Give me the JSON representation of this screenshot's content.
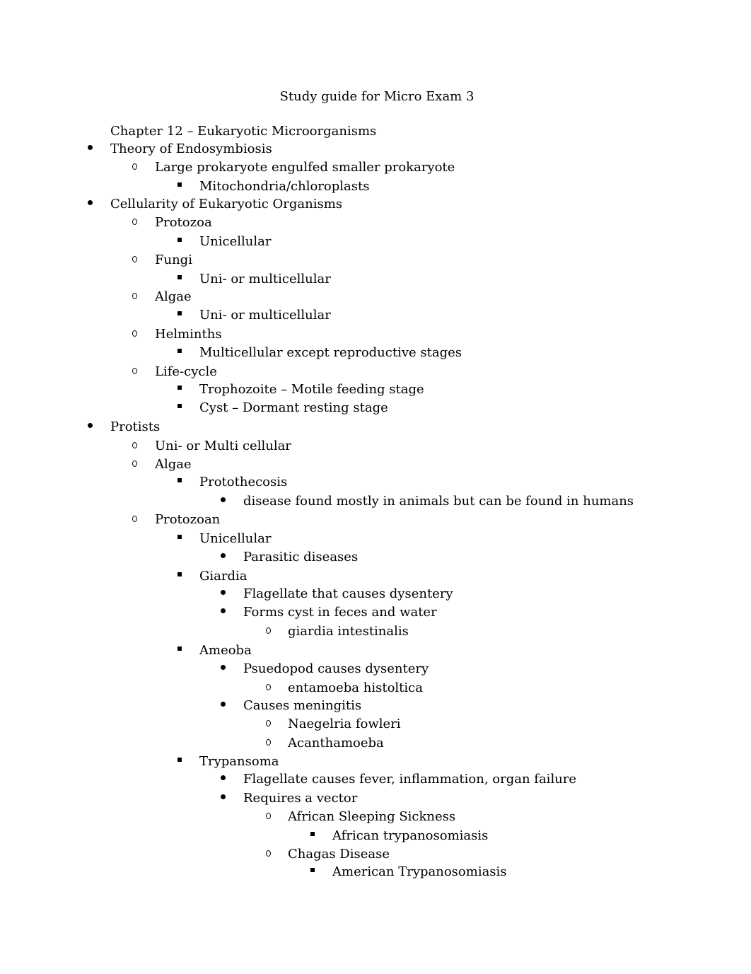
{
  "document": {
    "title": "Study guide for Micro Exam 3",
    "heading": "Chapter 12 – Eukaryotic Microorganisms",
    "items": [
      {
        "level": 1,
        "marker": "disc",
        "text": "Theory of Endosymbiosis"
      },
      {
        "level": 2,
        "marker": "circle",
        "text": "Large prokaryote engulfed smaller prokaryote"
      },
      {
        "level": 3,
        "marker": "square",
        "text": "Mitochondria/chloroplasts"
      },
      {
        "level": 1,
        "marker": "disc",
        "text": "Cellularity of Eukaryotic Organisms"
      },
      {
        "level": 2,
        "marker": "circle",
        "text": "Protozoa"
      },
      {
        "level": 3,
        "marker": "square",
        "text": "Unicellular"
      },
      {
        "level": 2,
        "marker": "circle",
        "text": "Fungi"
      },
      {
        "level": 3,
        "marker": "square",
        "text": "Uni- or multicellular"
      },
      {
        "level": 2,
        "marker": "circle",
        "text": "Algae"
      },
      {
        "level": 3,
        "marker": "square",
        "text": "Uni- or multicellular"
      },
      {
        "level": 2,
        "marker": "circle",
        "text": "Helminths"
      },
      {
        "level": 3,
        "marker": "square",
        "text": "Multicellular except reproductive stages"
      },
      {
        "level": 2,
        "marker": "circle",
        "text": "Life-cycle"
      },
      {
        "level": 3,
        "marker": "square",
        "text": "Trophozoite – Motile feeding stage"
      },
      {
        "level": 3,
        "marker": "square",
        "text": "Cyst – Dormant resting stage"
      },
      {
        "level": 1,
        "marker": "disc",
        "text": "Protists"
      },
      {
        "level": 2,
        "marker": "circle",
        "text": "Uni- or Multi cellular"
      },
      {
        "level": 2,
        "marker": "circle",
        "text": "Algae"
      },
      {
        "level": 3,
        "marker": "square",
        "text": "Protothecosis"
      },
      {
        "level": 4,
        "marker": "disc",
        "text": "disease found mostly in animals but can be found in humans"
      },
      {
        "level": 2,
        "marker": "circle",
        "text": "Protozoan"
      },
      {
        "level": 3,
        "marker": "square",
        "text": "Unicellular"
      },
      {
        "level": 4,
        "marker": "disc",
        "text": "Parasitic diseases"
      },
      {
        "level": 3,
        "marker": "square",
        "text": "Giardia"
      },
      {
        "level": 4,
        "marker": "disc",
        "text": "Flagellate that causes dysentery"
      },
      {
        "level": 4,
        "marker": "disc",
        "text": "Forms cyst in feces and water"
      },
      {
        "level": 5,
        "marker": "circle",
        "text": "giardia intestinalis"
      },
      {
        "level": 3,
        "marker": "square",
        "text": "Ameoba"
      },
      {
        "level": 4,
        "marker": "disc",
        "text": "Psuedopod causes dysentery"
      },
      {
        "level": 5,
        "marker": "circle",
        "text": "entamoeba histoltica"
      },
      {
        "level": 4,
        "marker": "disc",
        "text": "Causes meningitis"
      },
      {
        "level": 5,
        "marker": "circle",
        "text": "Naegelria fowleri"
      },
      {
        "level": 5,
        "marker": "circle",
        "text": "Acanthamoeba"
      },
      {
        "level": 3,
        "marker": "square",
        "text": "Trypansoma"
      },
      {
        "level": 4,
        "marker": "disc",
        "text": "Flagellate causes fever, inflammation, organ failure"
      },
      {
        "level": 4,
        "marker": "disc",
        "text": "Requires a vector"
      },
      {
        "level": 5,
        "marker": "circle",
        "text": "African Sleeping Sickness"
      },
      {
        "level": 6,
        "marker": "square",
        "text": "African trypanosomiasis"
      },
      {
        "level": 5,
        "marker": "circle",
        "text": "Chagas Disease"
      },
      {
        "level": 6,
        "marker": "square",
        "text": "American Trypanosomiasis"
      }
    ]
  }
}
